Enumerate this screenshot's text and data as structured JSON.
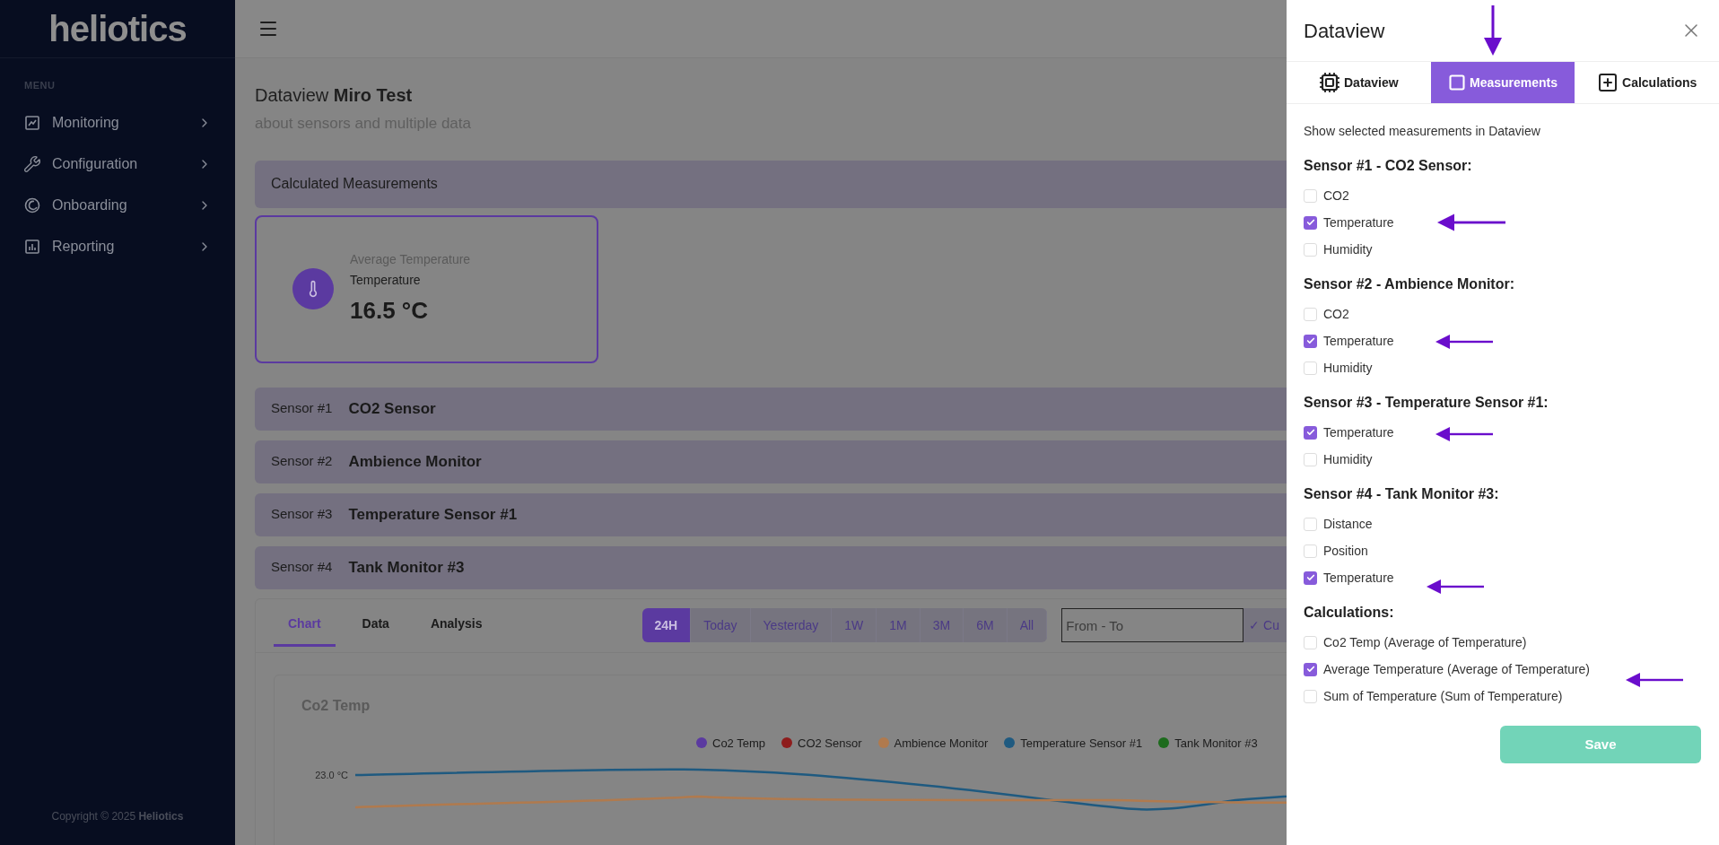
{
  "sidebar": {
    "logo": "heliotics",
    "menu_label": "MENU",
    "items": [
      {
        "label": "Monitoring"
      },
      {
        "label": "Configuration"
      },
      {
        "label": "Onboarding"
      },
      {
        "label": "Reporting"
      }
    ],
    "copyright": "Copyright © 2025 **Heliotics**"
  },
  "page": {
    "title": "Dataview **Miro Test**",
    "subtitle": "about sensors and multiple data"
  },
  "calculated": {
    "heading": "Calculated Measurements",
    "card": {
      "title": "Average Temperature",
      "type": "Temperature",
      "value": "16.5 °C"
    }
  },
  "sensors": [
    {
      "number": "Sensor #1",
      "name": "CO2 Sensor"
    },
    {
      "number": "Sensor #2",
      "name": "Ambience Monitor"
    },
    {
      "number": "Sensor #3",
      "name": "Temperature Sensor #1"
    },
    {
      "number": "Sensor #4",
      "name": "Tank Monitor #3"
    }
  ],
  "view_tabs": [
    {
      "label": "Chart",
      "selected": true
    },
    {
      "label": "Data",
      "selected": false
    },
    {
      "label": "Analysis",
      "selected": false
    }
  ],
  "ranges": [
    {
      "label": "24H",
      "selected": true
    },
    {
      "label": "Today",
      "selected": false
    },
    {
      "label": "Yesterday",
      "selected": false
    },
    {
      "label": "1W",
      "selected": false
    },
    {
      "label": "1M",
      "selected": false
    },
    {
      "label": "3M",
      "selected": false
    },
    {
      "label": "6M",
      "selected": false
    },
    {
      "label": "All",
      "selected": false
    }
  ],
  "date_field": {
    "placeholder": "From - To"
  },
  "custom_button": "✓ Cu",
  "chart": {
    "title": "Co2 Temp",
    "tick": "23.0 °C",
    "legend": [
      {
        "label": "Co2 Temp",
        "color": "#5b3aa0"
      },
      {
        "label": "CO2 Sensor",
        "color": "#8e1c1c"
      },
      {
        "label": "Ambience Monitor",
        "color": "#b07a4e"
      },
      {
        "label": "Temperature Sensor #1",
        "color": "#1f5a80"
      },
      {
        "label": "Tank Monitor #3",
        "color": "#1d6b1d"
      }
    ]
  },
  "drawer": {
    "title": "Dataview",
    "tabs": [
      {
        "label": "Dataview",
        "selected": false
      },
      {
        "label": "Measurements",
        "selected": true
      },
      {
        "label": "Calculations",
        "selected": false
      }
    ],
    "description": "Show selected measurements in Dataview",
    "groups": [
      {
        "heading": "Sensor #1 - CO2 Sensor:",
        "options": [
          {
            "label": "CO2",
            "checked": false
          },
          {
            "label": "Temperature",
            "checked": true
          },
          {
            "label": "Humidity",
            "checked": false
          }
        ]
      },
      {
        "heading": "Sensor #2 - Ambience Monitor:",
        "options": [
          {
            "label": "CO2",
            "checked": false
          },
          {
            "label": "Temperature",
            "checked": true
          },
          {
            "label": "Humidity",
            "checked": false
          }
        ]
      },
      {
        "heading": "Sensor #3 - Temperature Sensor #1:",
        "options": [
          {
            "label": "Temperature",
            "checked": true
          },
          {
            "label": "Humidity",
            "checked": false
          }
        ]
      },
      {
        "heading": "Sensor #4 - Tank Monitor #3:",
        "options": [
          {
            "label": "Distance",
            "checked": false
          },
          {
            "label": "Position",
            "checked": false
          },
          {
            "label": "Temperature",
            "checked": true
          }
        ]
      },
      {
        "heading": "Calculations:",
        "options": [
          {
            "label": "Co2 Temp (Average of Temperature)",
            "checked": false
          },
          {
            "label": "Average Temperature (Average of Temperature)",
            "checked": true
          },
          {
            "label": "Sum of Temperature (Sum of Temperature)",
            "checked": false
          }
        ]
      }
    ],
    "save": "Save"
  }
}
